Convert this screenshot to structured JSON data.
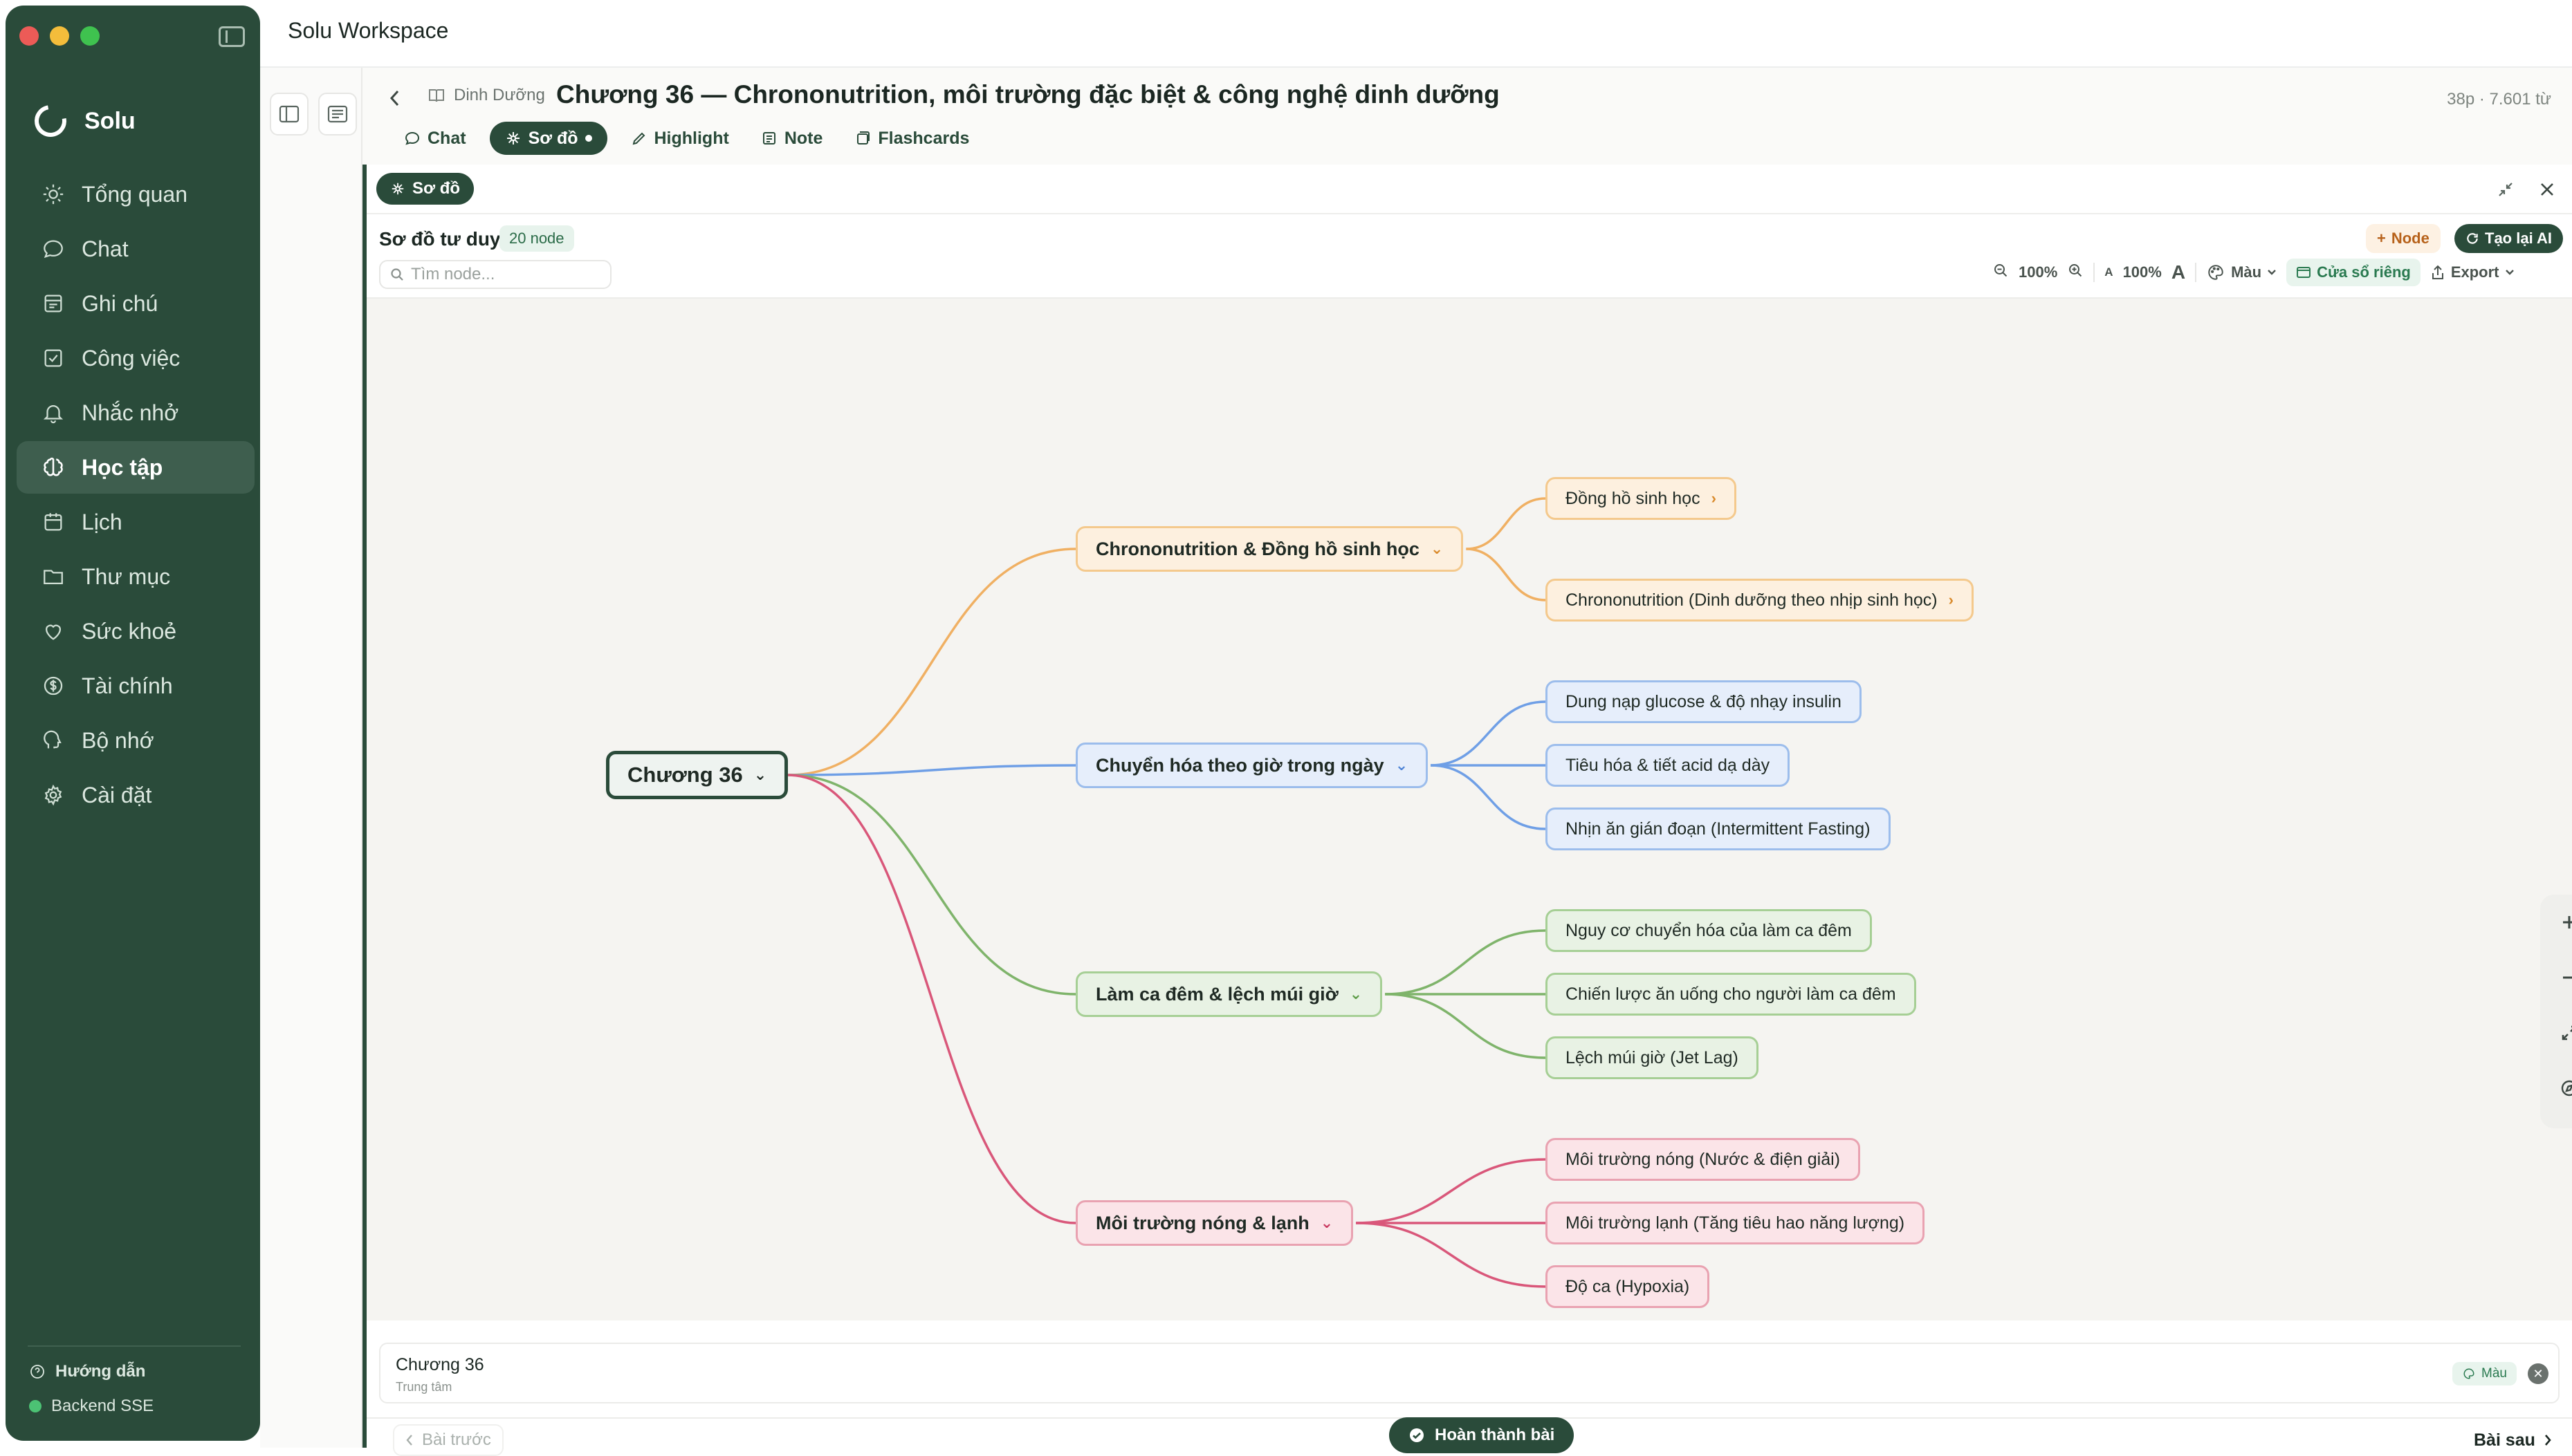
{
  "app": {
    "title": "Solu Workspace",
    "brand": "Solu"
  },
  "sidebar": {
    "items": [
      {
        "label": "Tổng quan",
        "icon": "sun-icon",
        "active": false
      },
      {
        "label": "Chat",
        "icon": "chat-bubble-icon",
        "active": false
      },
      {
        "label": "Ghi chú",
        "icon": "notes-icon",
        "active": false
      },
      {
        "label": "Công việc",
        "icon": "checkbox-icon",
        "active": false
      },
      {
        "label": "Nhắc nhở",
        "icon": "bell-icon",
        "active": false
      },
      {
        "label": "Học tập",
        "icon": "brain-icon",
        "active": true
      },
      {
        "label": "Lịch",
        "icon": "calendar-icon",
        "active": false
      },
      {
        "label": "Thư mục",
        "icon": "folder-icon",
        "active": false
      },
      {
        "label": "Sức khoẻ",
        "icon": "heart-icon",
        "active": false
      },
      {
        "label": "Tài chính",
        "icon": "dollar-icon",
        "active": false
      },
      {
        "label": "Bộ nhớ",
        "icon": "head-icon",
        "active": false
      },
      {
        "label": "Cài đặt",
        "icon": "gear-icon",
        "active": false
      }
    ],
    "help_label": "Hướng dẫn",
    "status_label": "Backend SSE"
  },
  "lesson": {
    "breadcrumb": "Dinh Dưỡng",
    "title": "Chương 36 — Chrononutrition, môi trường đặc biệt & công nghệ dinh dưỡng",
    "meta": "38p · 7.601 từ"
  },
  "tabs": [
    {
      "label": "Chat",
      "icon": "chat-bubble-icon",
      "active": false
    },
    {
      "label": "Sơ đồ",
      "icon": "mindmap-icon",
      "active": true
    },
    {
      "label": "Highlight",
      "icon": "pen-icon",
      "active": false
    },
    {
      "label": "Note",
      "icon": "note-icon",
      "active": false
    },
    {
      "label": "Flashcards",
      "icon": "cards-icon",
      "active": false
    }
  ],
  "panel": {
    "chip_label": "Sơ đồ",
    "mindmap_title": "Sơ đồ tư duy",
    "node_count": "20 node",
    "search_placeholder": "Tìm node...",
    "add_node_label": "Node",
    "regen_label": "Tạo lại AI",
    "zoom": "100%",
    "font_scale": "100%",
    "color_label": "Màu",
    "window_label": "Cửa sổ riêng",
    "export_label": "Export"
  },
  "mindmap": {
    "root": "Chương 36",
    "branches": [
      {
        "label": "Chrononutrition & Đồng hồ sinh học",
        "color": "#f0b063",
        "children": [
          "Đồng hồ sinh học",
          "Chrononutrition (Dinh dưỡng theo nhịp sinh học)"
        ]
      },
      {
        "label": "Chuyển hóa theo giờ trong ngày",
        "color": "#6f9fe6",
        "children": [
          "Dung nạp glucose & độ nhạy insulin",
          "Tiêu hóa & tiết acid dạ dày",
          "Nhịn ăn gián đoạn (Intermittent Fasting)"
        ]
      },
      {
        "label": "Làm ca đêm & lệch múi giờ",
        "color": "#7fb46b",
        "children": [
          "Nguy cơ chuyển hóa của làm ca đêm",
          "Chiến lược ăn uống cho người làm ca đêm",
          "Lệch múi giờ (Jet Lag)"
        ]
      },
      {
        "label": "Môi trường nóng & lạnh",
        "color": "#d9577a",
        "children": [
          "Môi trường nóng (Nước & điện giải)",
          "Môi trường lạnh (Tăng tiêu hao năng lượng)",
          "Độ ca (Hypoxia)"
        ]
      }
    ]
  },
  "selection": {
    "title": "Chương 36",
    "subtitle": "Trung tâm",
    "color_label": "Màu"
  },
  "footer": {
    "prev_label": "Bài trước",
    "done_label": "Hoàn thành bài",
    "next_label": "Bài sau"
  },
  "colors": {
    "sidebar_bg": "#2a4b3a",
    "accent": "#2a4b3a"
  }
}
